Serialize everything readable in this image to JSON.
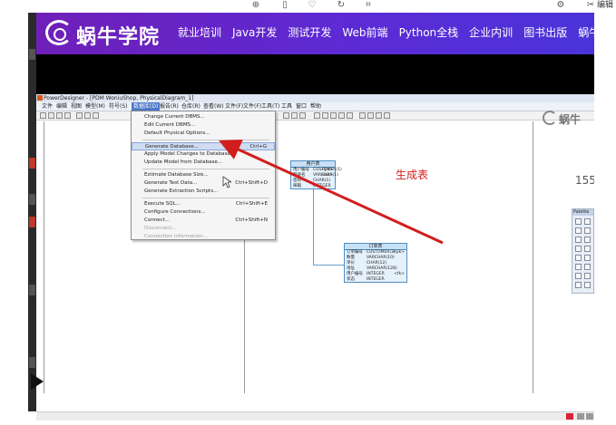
{
  "viewer": {
    "toolbar_icons": [
      "zoom-in-icon",
      "trash-icon",
      "heart-icon",
      "rotate-icon",
      "crop-icon",
      "settings-icon"
    ],
    "edit_label": "编辑"
  },
  "site": {
    "logo_text": "蜗牛学院",
    "nav": [
      "就业培训",
      "Java开发",
      "测试开发",
      "Web前端",
      "Python全栈",
      "企业内训",
      "图书出版",
      "蜗牛笔记"
    ]
  },
  "powerdesigner": {
    "title": "PowerDesigner - [PDM WoniuShop, PhysicalDiagram_1]",
    "menus": [
      "文件",
      "编辑",
      "视图",
      "模型(M)",
      "符号(S)",
      "数据库(D)",
      "报告(R)",
      "仓库(R)",
      "查看(W)",
      "文件(F)",
      "文件(F)",
      "工具(T)",
      "工具",
      "窗口",
      "帮助"
    ],
    "active_menu_index": 5,
    "dropdown": [
      {
        "label": "Change Current DBMS...",
        "shortcut": "",
        "state": "normal"
      },
      {
        "label": "Edit Current DBMS...",
        "shortcut": "",
        "state": "normal"
      },
      {
        "label": "Default Physical Options...",
        "shortcut": "",
        "state": "normal"
      },
      {
        "sep": true
      },
      {
        "label": "Generate Database...",
        "shortcut": "Ctrl+G",
        "state": "highlight"
      },
      {
        "label": "Apply Model Changes to Database...",
        "shortcut": "",
        "state": "normal"
      },
      {
        "label": "Update Model from Database...",
        "shortcut": "",
        "state": "normal"
      },
      {
        "sep": true
      },
      {
        "label": "Estimate Database Size...",
        "shortcut": "",
        "state": "normal"
      },
      {
        "label": "Generate Test Data...",
        "shortcut": "Ctrl+Shift+D",
        "state": "normal"
      },
      {
        "label": "Generate Extraction Scripts...",
        "shortcut": "",
        "state": "normal"
      },
      {
        "sep": true
      },
      {
        "label": "Execute SQL...",
        "shortcut": "Ctrl+Shift+E",
        "state": "normal"
      },
      {
        "label": "Configure Connections...",
        "shortcut": "",
        "state": "normal"
      },
      {
        "label": "Connect...",
        "shortcut": "Ctrl+Shift+N",
        "state": "normal"
      },
      {
        "label": "Disconnect...",
        "shortcut": "",
        "state": "disabled"
      },
      {
        "label": "Connection Information...",
        "shortcut": "",
        "state": "disabled"
      }
    ],
    "table_user": {
      "title": "用户表",
      "rows": [
        [
          "用户编号",
          "CUSTOMER(1)",
          "<pk>"
        ],
        [
          "登录名",
          "VARCHAR(1)",
          "<ak>"
        ],
        [
          "密码",
          "CHAR(1)",
          ""
        ],
        [
          "邮箱",
          "INTEGER",
          ""
        ]
      ]
    },
    "table_order": {
      "title": "订单表",
      "rows": [
        [
          "订单编号",
          "CUSTOMER(2)",
          "<pk>"
        ],
        [
          "数量",
          "VARCHAR(10)",
          ""
        ],
        [
          "单价",
          "CHAR(12)",
          ""
        ],
        [
          "地址",
          "VARCHAR(128)",
          ""
        ],
        [
          "用户编号",
          "INTEGER",
          "<fk>"
        ],
        [
          "状态",
          "INTEGER",
          ""
        ]
      ]
    },
    "palette_title": "Palette"
  },
  "annotation": {
    "label": "生成表",
    "color": "#d21d1d"
  },
  "side": {
    "logo_text": "蜗牛",
    "number": "155"
  }
}
